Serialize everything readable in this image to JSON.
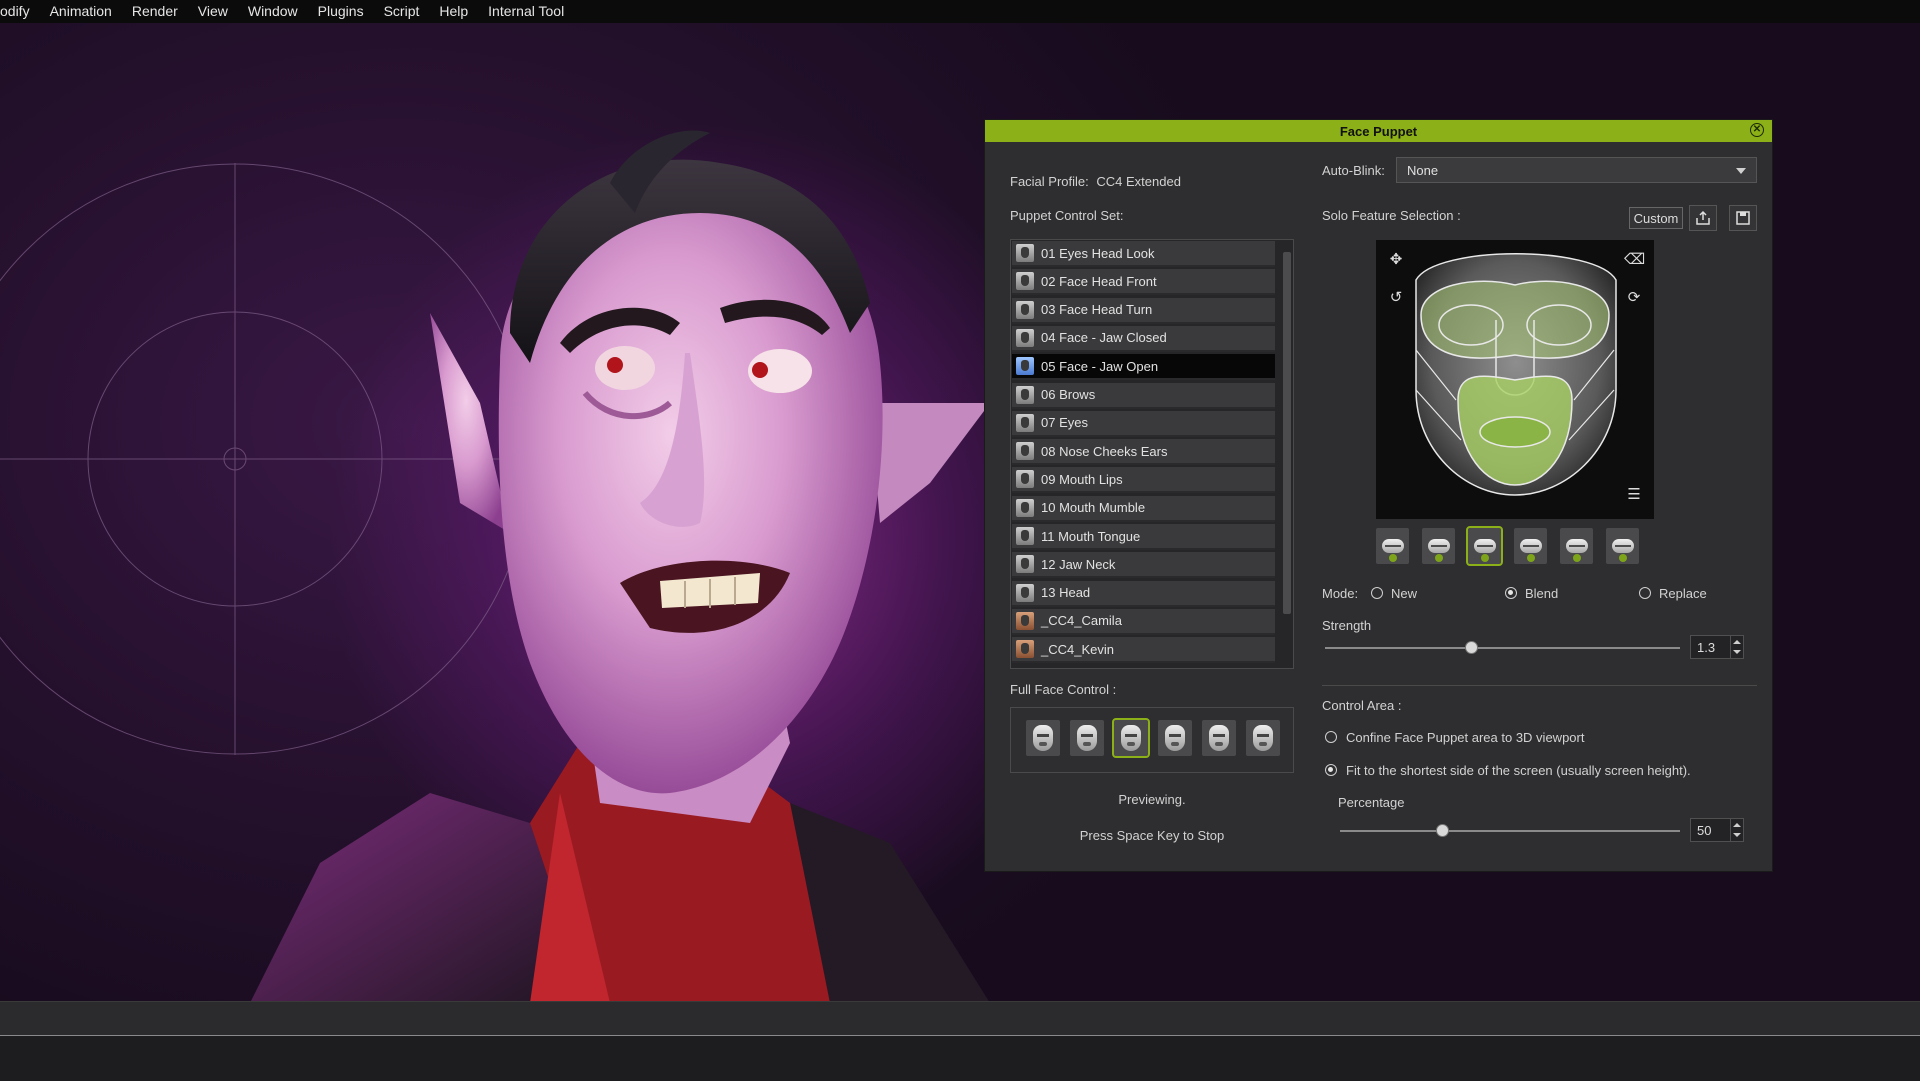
{
  "menu": {
    "items": [
      "odify",
      "Animation",
      "Render",
      "View",
      "Window",
      "Plugins",
      "Script",
      "Help",
      "Internal Tool"
    ]
  },
  "panel": {
    "title": "Face Puppet",
    "facial_profile_label": "Facial Profile:",
    "facial_profile_value": "CC4 Extended",
    "puppet_control_set_label": "Puppet Control Set:",
    "puppet_items": [
      {
        "label": "01 Eyes Head Look",
        "selected": false,
        "thumb": "gray"
      },
      {
        "label": "02 Face Head Front",
        "selected": false,
        "thumb": "gray"
      },
      {
        "label": "03 Face Head Turn",
        "selected": false,
        "thumb": "gray"
      },
      {
        "label": "04 Face - Jaw Closed",
        "selected": false,
        "thumb": "gray"
      },
      {
        "label": "05 Face - Jaw Open",
        "selected": true,
        "thumb": "blue"
      },
      {
        "label": "06 Brows",
        "selected": false,
        "thumb": "gray"
      },
      {
        "label": "07 Eyes",
        "selected": false,
        "thumb": "gray"
      },
      {
        "label": "08 Nose Cheeks Ears",
        "selected": false,
        "thumb": "gray"
      },
      {
        "label": "09 Mouth Lips",
        "selected": false,
        "thumb": "gray"
      },
      {
        "label": "10 Mouth Mumble",
        "selected": false,
        "thumb": "gray"
      },
      {
        "label": "11 Mouth Tongue",
        "selected": false,
        "thumb": "gray"
      },
      {
        "label": "12 Jaw Neck",
        "selected": false,
        "thumb": "gray"
      },
      {
        "label": "13 Head",
        "selected": false,
        "thumb": "gray"
      },
      {
        "label": "_CC4_Camila",
        "selected": false,
        "thumb": "skin"
      },
      {
        "label": "_CC4_Kevin",
        "selected": false,
        "thumb": "skin"
      }
    ],
    "full_face_control_label": "Full Face Control :",
    "full_face_active_index": 2,
    "status_previewing": "Previewing.",
    "status_hint": "Press Space Key to Stop",
    "auto_blink_label": "Auto-Blink:",
    "auto_blink_value": "None",
    "solo_feature_label": "Solo Feature Selection :",
    "custom_button": "Custom",
    "feature_active_index": 2,
    "mode_label": "Mode:",
    "mode_options": [
      "New",
      "Blend",
      "Replace"
    ],
    "mode_selected": "Blend",
    "strength_label": "Strength",
    "strength_value": "1.3",
    "strength_fraction": 0.41,
    "control_area_label": "Control Area :",
    "control_area_options": [
      "Confine Face Puppet area to 3D viewport",
      "Fit to the shortest side of the screen (usually screen height)."
    ],
    "control_area_selected_index": 1,
    "percentage_label": "Percentage",
    "percentage_value": "50",
    "percentage_fraction": 0.3
  },
  "colors": {
    "accent": "#8cb017",
    "panel_bg": "#2e2e30",
    "selected_row": "#070707"
  }
}
